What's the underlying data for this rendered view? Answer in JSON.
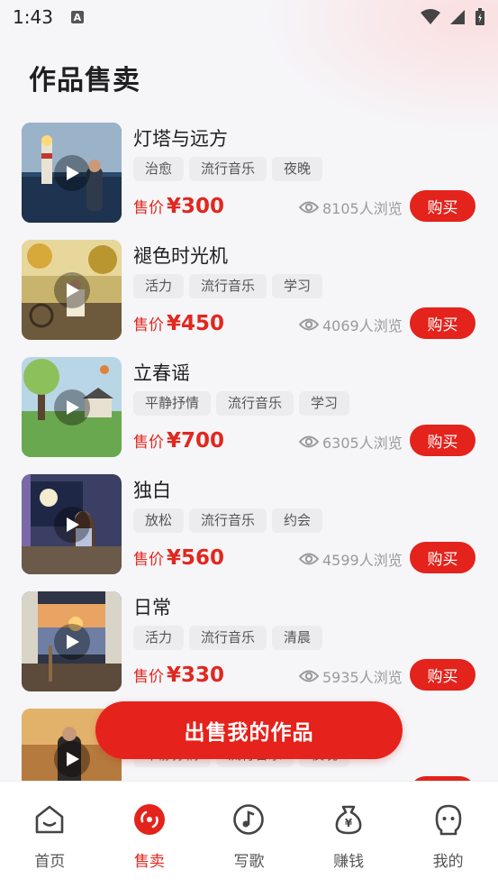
{
  "status_bar": {
    "time": "1:43",
    "a_badge": "A"
  },
  "page": {
    "title": "作品售卖"
  },
  "price_label": "售价",
  "buy_label": "购买",
  "items": [
    {
      "title": "灯塔与远方",
      "tags": [
        "治愈",
        "流行音乐",
        "夜晚"
      ],
      "price": "¥300",
      "views": "8105人浏览"
    },
    {
      "title": "褪色时光机",
      "tags": [
        "活力",
        "流行音乐",
        "学习"
      ],
      "price": "¥450",
      "views": "4069人浏览"
    },
    {
      "title": "立春谣",
      "tags": [
        "平静抒情",
        "流行音乐",
        "学习"
      ],
      "price": "¥700",
      "views": "6305人浏览"
    },
    {
      "title": "独白",
      "tags": [
        "放松",
        "流行音乐",
        "约会"
      ],
      "price": "¥560",
      "views": "4599人浏览"
    },
    {
      "title": "日常",
      "tags": [
        "活力",
        "流行音乐",
        "清晨"
      ],
      "price": "¥330",
      "views": "5935人浏览"
    },
    {
      "title": "",
      "tags": [
        "平静抒情",
        "流行音乐",
        "夜晚"
      ],
      "price": "",
      "views": ""
    }
  ],
  "sell_button": "出售我的作品",
  "tabs": [
    {
      "label": "首页",
      "icon": "home-icon",
      "active": false
    },
    {
      "label": "售卖",
      "icon": "record-icon",
      "active": true
    },
    {
      "label": "写歌",
      "icon": "music-note-icon",
      "active": false
    },
    {
      "label": "赚钱",
      "icon": "money-bag-icon",
      "active": false
    },
    {
      "label": "我的",
      "icon": "profile-icon",
      "active": false
    }
  ],
  "colors": {
    "accent": "#e3231c",
    "background": "#f6f5f8"
  }
}
